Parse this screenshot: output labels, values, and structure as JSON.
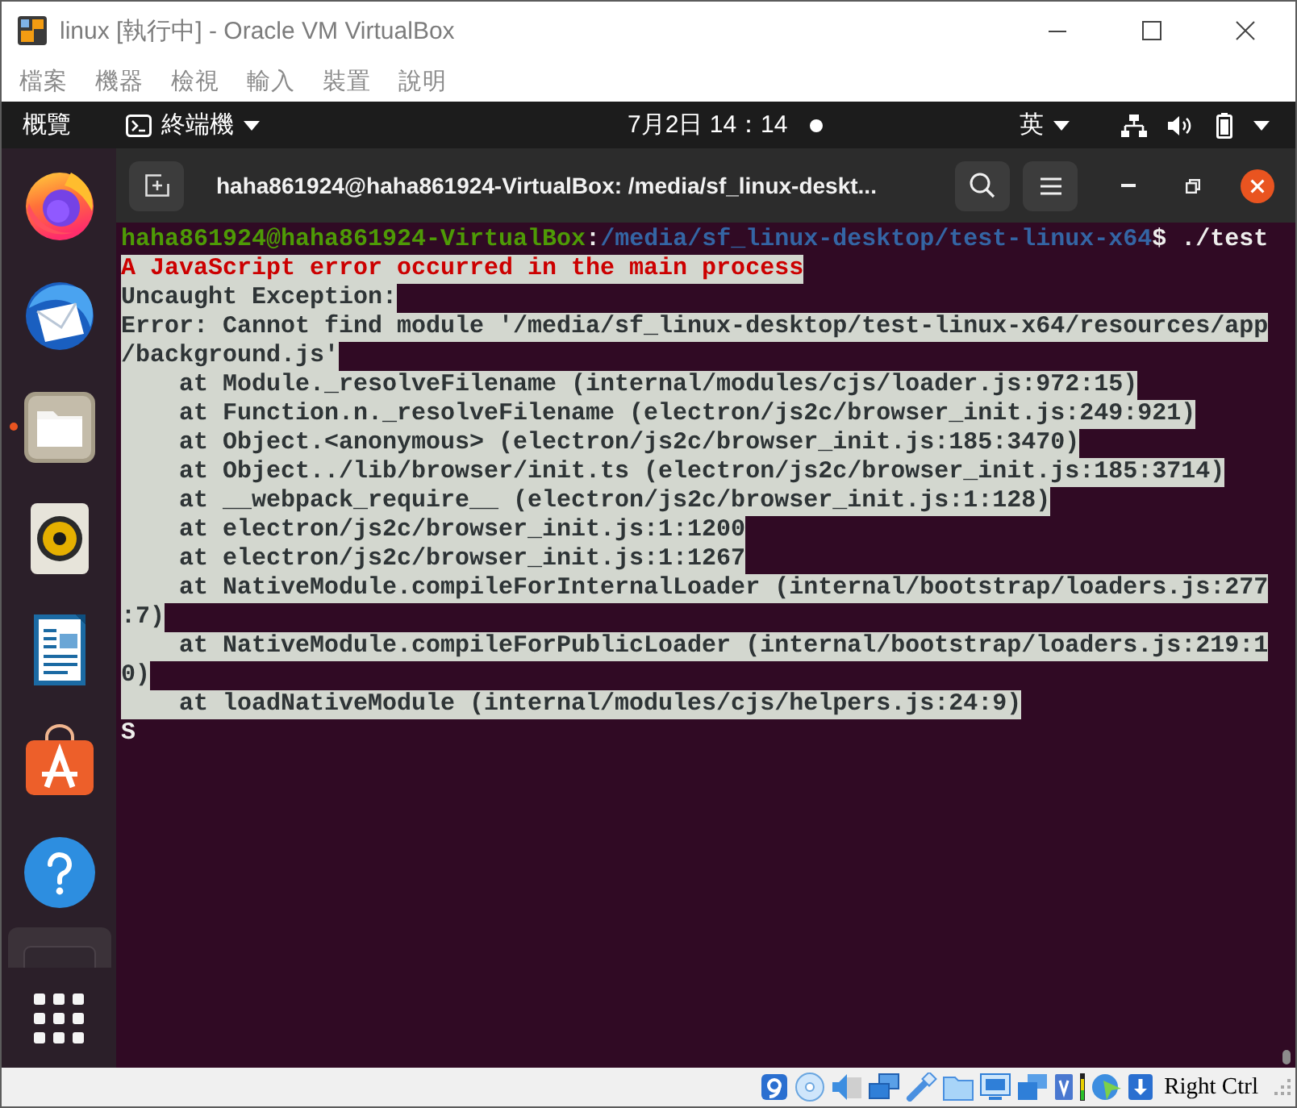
{
  "window": {
    "title": "linux [執行中] - Oracle VM VirtualBox"
  },
  "menu": [
    "檔案",
    "機器",
    "檢視",
    "輸入",
    "裝置",
    "說明"
  ],
  "top_panel": {
    "activities": "概覽",
    "app_menu": "終端機",
    "clock": "7月2日 14：14",
    "input_method": "英"
  },
  "dock": {
    "items": [
      {
        "kind": "browser",
        "running": false
      },
      {
        "kind": "mail",
        "running": false
      },
      {
        "kind": "files",
        "running": true
      },
      {
        "kind": "music",
        "running": false
      },
      {
        "kind": "writer",
        "running": false
      },
      {
        "kind": "store",
        "running": false
      },
      {
        "kind": "help",
        "running": false
      }
    ]
  },
  "terminal": {
    "title": "haha861924@haha861924-VirtualBox: /media/sf_linux-deskt...",
    "lines": [
      {
        "selected": false,
        "spans": [
          {
            "kind": "user",
            "text": "haha861924@haha861924-VirtualBox"
          },
          {
            "kind": "plain",
            "text": ":"
          },
          {
            "kind": "path",
            "text": "/media/sf_linux-desktop/test-linux-x64"
          },
          {
            "kind": "plain",
            "text": "$ ./test"
          }
        ]
      },
      {
        "selected": true,
        "spans": [
          {
            "kind": "error",
            "text": "A JavaScript error occurred in the main process"
          }
        ]
      },
      {
        "selected": true,
        "spans": [
          {
            "kind": "plain",
            "text": "Uncaught Exception:"
          }
        ]
      },
      {
        "selected": true,
        "spans": [
          {
            "kind": "plain",
            "text": "Error: Cannot find module '/media/sf_linux-desktop/test-linux-x64/resources/app"
          }
        ]
      },
      {
        "selected": true,
        "spans": [
          {
            "kind": "plain",
            "text": "/background.js'"
          }
        ]
      },
      {
        "selected": true,
        "spans": [
          {
            "kind": "plain",
            "text": "    at Module._resolveFilename (internal/modules/cjs/loader.js:972:15)"
          }
        ]
      },
      {
        "selected": true,
        "spans": [
          {
            "kind": "plain",
            "text": "    at Function.n._resolveFilename (electron/js2c/browser_init.js:249:921)"
          }
        ]
      },
      {
        "selected": true,
        "spans": [
          {
            "kind": "plain",
            "text": "    at Object.<anonymous> (electron/js2c/browser_init.js:185:3470)"
          }
        ]
      },
      {
        "selected": true,
        "spans": [
          {
            "kind": "plain",
            "text": "    at Object../lib/browser/init.ts (electron/js2c/browser_init.js:185:3714)"
          }
        ]
      },
      {
        "selected": true,
        "spans": [
          {
            "kind": "plain",
            "text": "    at __webpack_require__ (electron/js2c/browser_init.js:1:128)"
          }
        ]
      },
      {
        "selected": true,
        "spans": [
          {
            "kind": "plain",
            "text": "    at electron/js2c/browser_init.js:1:1200"
          }
        ]
      },
      {
        "selected": true,
        "spans": [
          {
            "kind": "plain",
            "text": "    at electron/js2c/browser_init.js:1:1267"
          }
        ]
      },
      {
        "selected": true,
        "spans": [
          {
            "kind": "plain",
            "text": "    at NativeModule.compileForInternalLoader (internal/bootstrap/loaders.js:277"
          }
        ]
      },
      {
        "selected": true,
        "spans": [
          {
            "kind": "plain",
            "text": ":7)"
          }
        ]
      },
      {
        "selected": true,
        "spans": [
          {
            "kind": "plain",
            "text": "    at NativeModule.compileForPublicLoader (internal/bootstrap/loaders.js:219:1"
          }
        ]
      },
      {
        "selected": true,
        "spans": [
          {
            "kind": "plain",
            "text": "0)"
          }
        ]
      },
      {
        "selected": true,
        "spans": [
          {
            "kind": "plain",
            "text": "    at loadNativeModule (internal/modules/cjs/helpers.js:24:9)"
          }
        ]
      },
      {
        "selected": false,
        "spans": [
          {
            "kind": "plain",
            "text": "S"
          }
        ]
      }
    ]
  },
  "status_bar": {
    "host_key": "Right Ctrl"
  }
}
